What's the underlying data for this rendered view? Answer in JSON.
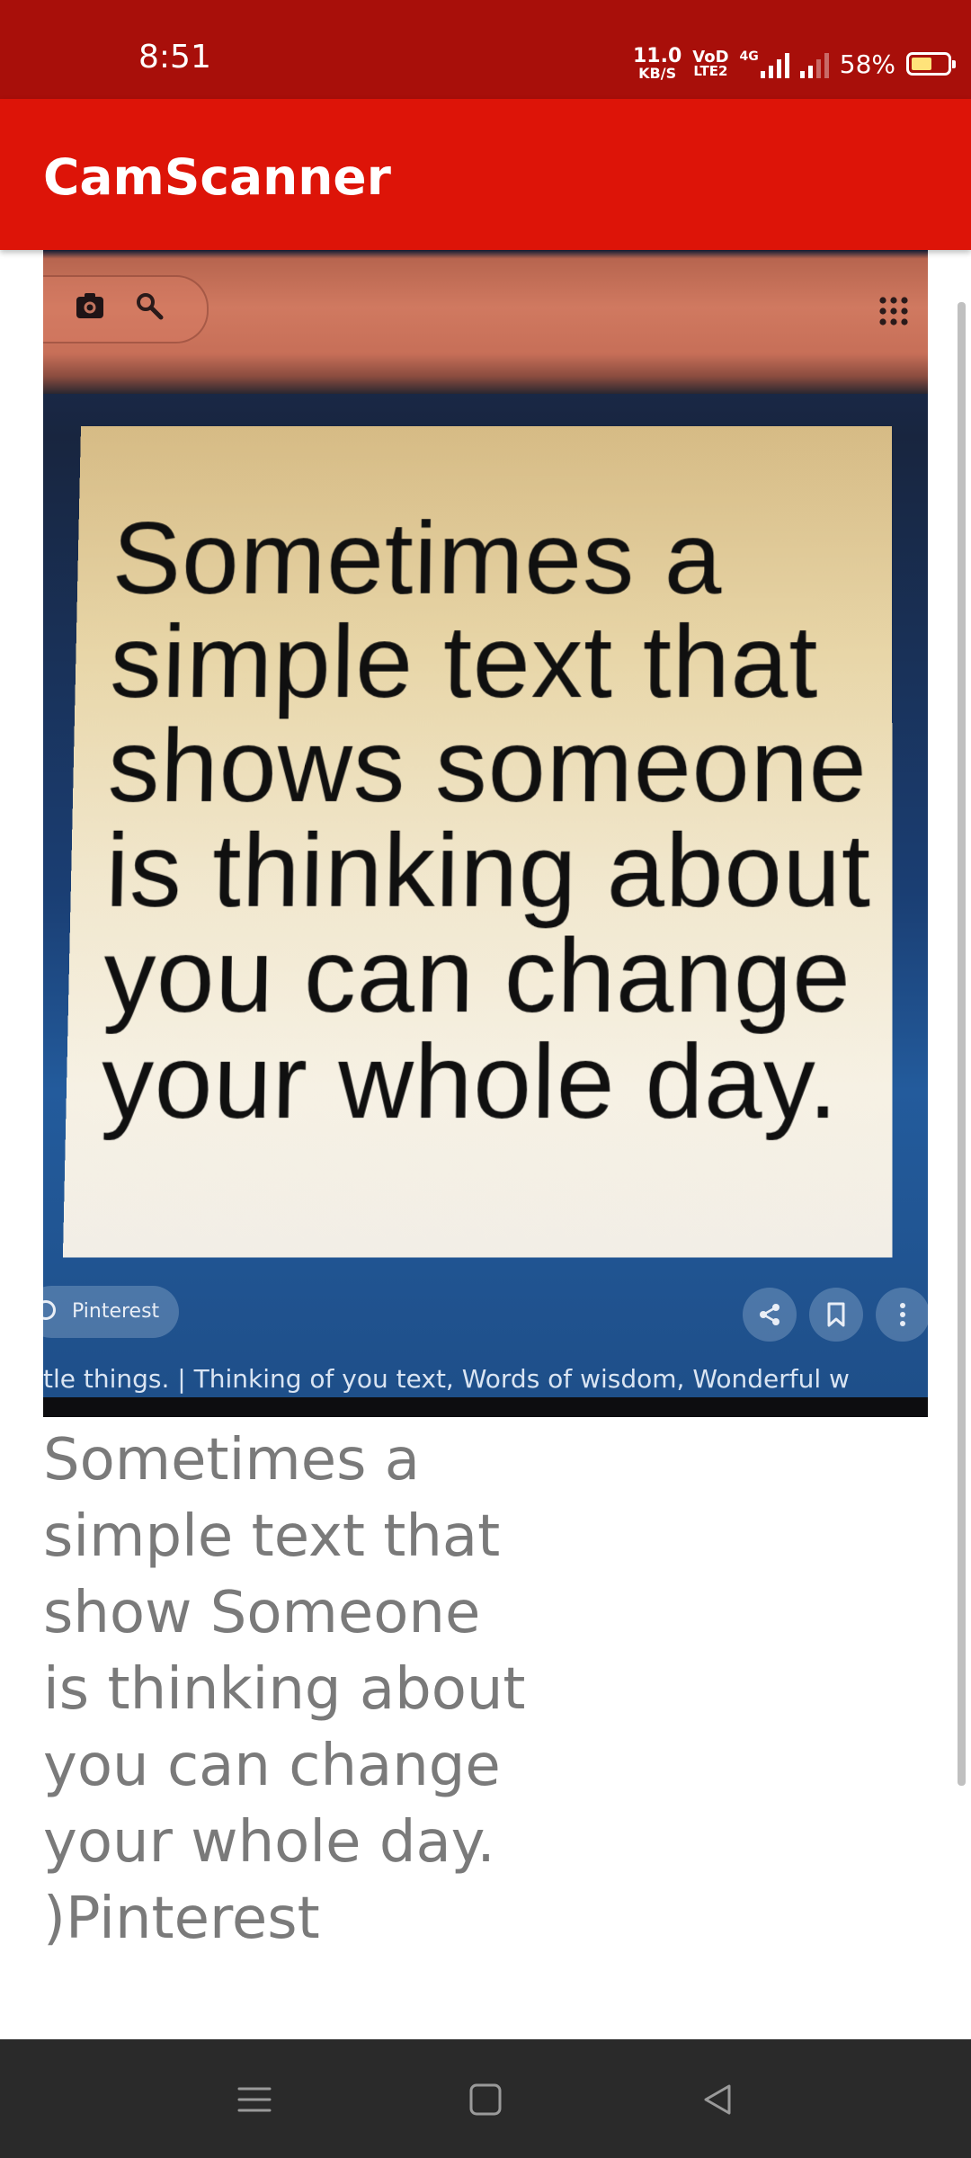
{
  "status_bar": {
    "time": "8:51",
    "net_speed_value": "11.0",
    "net_speed_unit": "KB/S",
    "volte_top": "VoD",
    "volte_bottom": "LTE2",
    "network_type": "4G",
    "battery_percent": "58%",
    "battery_level": 0.58
  },
  "app_bar": {
    "title": "CamScanner"
  },
  "scan": {
    "quote_text": "Sometimes a\nsimple text that\nshows someone\nis thinking about\nyou can change\nyour whole day.",
    "source_label": "Pinterest",
    "caption_strip": "tle things. | Thinking of you text, Words of wisdom, Wonderful w"
  },
  "ocr": {
    "text": "Sometimes a\nsimple text that\nshow Someone\nis thinking about\nyou can change\nyour whole day.\n)Pinterest"
  },
  "colors": {
    "status_bar": "#a80f0a",
    "app_bar": "#dd1408",
    "ocr_text": "#7a7a7a",
    "nav_bar": "#2a2a2a"
  }
}
